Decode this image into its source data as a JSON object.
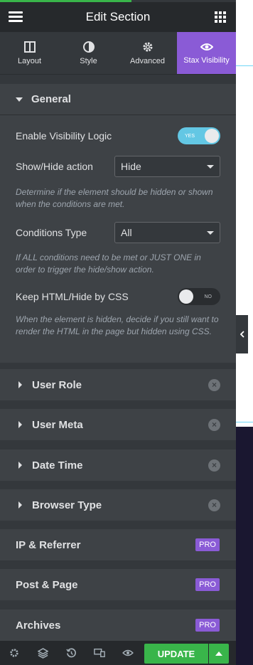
{
  "header": {
    "title": "Edit Section"
  },
  "tabs": [
    {
      "label": "Layout",
      "icon": "layout-icon"
    },
    {
      "label": "Style",
      "icon": "style-icon"
    },
    {
      "label": "Advanced",
      "icon": "gear-icon"
    },
    {
      "label": "Stax Visibility",
      "icon": "eye-icon",
      "active": true
    }
  ],
  "general": {
    "title": "General",
    "enable_label": "Enable Visibility Logic",
    "enable_toggle": "YES",
    "showhide_label": "Show/Hide action",
    "showhide_value": "Hide",
    "showhide_help": "Determine if the element should be hidden or shown when the conditions are met.",
    "conditions_label": "Conditions Type",
    "conditions_value": "All",
    "conditions_help": "If ALL conditions need to be met or JUST ONE in order to trigger the hide/show action.",
    "keep_label": "Keep HTML/Hide by CSS",
    "keep_toggle": "NO",
    "keep_help": "When the element is hidden, decide if you still want to render the HTML in the page but hidden using CSS."
  },
  "sections": [
    {
      "label": "User Role"
    },
    {
      "label": "User Meta"
    },
    {
      "label": "Date Time"
    },
    {
      "label": "Browser Type"
    }
  ],
  "pro_sections": [
    {
      "label": "IP & Referrer",
      "badge": "PRO"
    },
    {
      "label": "Post & Page",
      "badge": "PRO"
    },
    {
      "label": "Archives",
      "badge": "PRO"
    }
  ],
  "footer": {
    "update_label": "UPDATE"
  },
  "colors": {
    "accent": "#8a5bd6",
    "update": "#39b54a",
    "toggle_on": "#63c7e4"
  }
}
